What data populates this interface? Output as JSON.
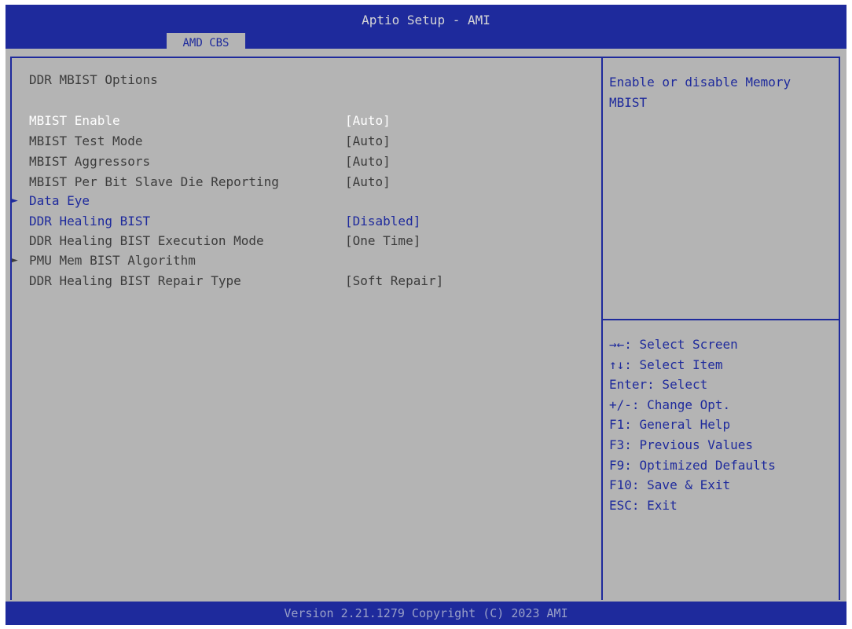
{
  "header": {
    "title": "Aptio Setup - AMI",
    "tab": "AMD CBS"
  },
  "main": {
    "section_title": "DDR MBIST Options",
    "items": [
      {
        "label": "MBIST Enable",
        "value": "[Auto]"
      },
      {
        "label": "MBIST Test Mode",
        "value": "[Auto]"
      },
      {
        "label": "MBIST Aggressors",
        "value": "[Auto]"
      },
      {
        "label": "MBIST Per Bit Slave Die Reporting",
        "value": "[Auto]"
      },
      {
        "label": "Data Eye",
        "value": ""
      },
      {
        "label": "DDR Healing BIST",
        "value": "[Disabled]"
      },
      {
        "label": "DDR Healing BIST Execution Mode",
        "value": "[One Time]"
      },
      {
        "label": "PMU Mem BIST Algorithm",
        "value": ""
      },
      {
        "label": "DDR Healing BIST Repair Type",
        "value": "[Soft Repair]"
      }
    ],
    "submenu_arrow": "►"
  },
  "help": {
    "text": "Enable or disable Memory MBIST",
    "keys": [
      "→←: Select Screen",
      "↑↓: Select Item",
      "Enter: Select",
      "+/-: Change Opt.",
      "F1: General Help",
      "F3: Previous Values",
      "F9: Optimized Defaults",
      "F10: Save & Exit",
      "ESC: Exit"
    ]
  },
  "footer": {
    "version": "Version 2.21.1279 Copyright (C) 2023 AMI"
  },
  "colors": {
    "header_bg": "#1e2a9c",
    "panel_bg": "#b4b4b4",
    "text": "#3c3c3c",
    "highlight": "#ffffff",
    "accent": "#1e2a9c"
  }
}
